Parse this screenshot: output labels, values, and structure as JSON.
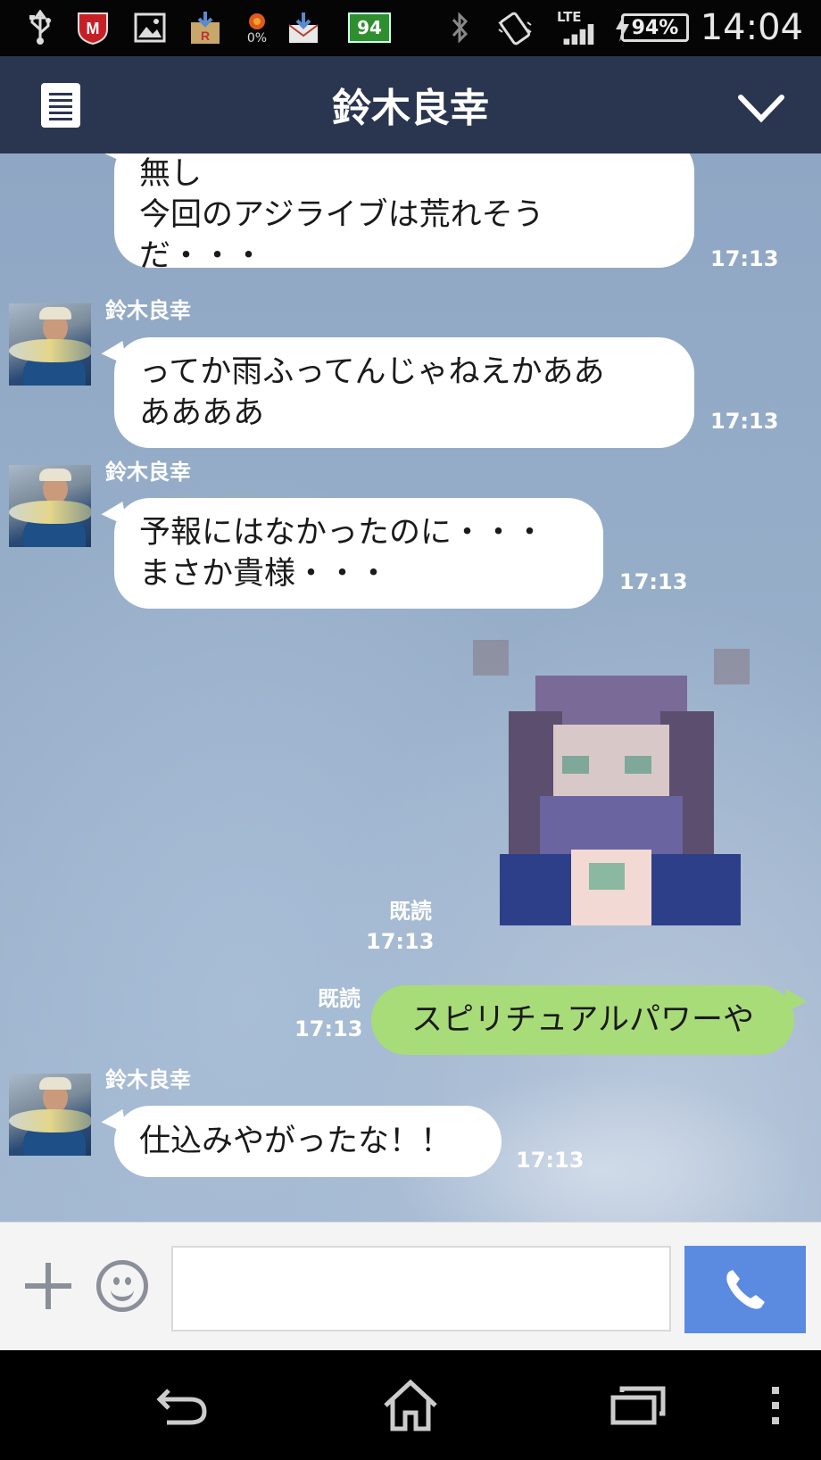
{
  "status_bar": {
    "notification_94": "94",
    "percent_badge": "0%",
    "network": "LTE",
    "battery": "94%",
    "time": "14:04"
  },
  "header": {
    "title": "鈴木良幸"
  },
  "messages": [
    {
      "side": "in",
      "lines": [
        "無し",
        "今回のアジライブは荒れそう",
        "だ・・・"
      ],
      "time": "17:13"
    },
    {
      "side": "in",
      "sender": "鈴木良幸",
      "lines": [
        "ってか雨ふってんじゃねえかああ",
        "ああああ"
      ],
      "time": "17:13"
    },
    {
      "side": "in",
      "sender": "鈴木良幸",
      "lines": [
        "予報にはなかったのに・・・",
        "まさか貴様・・・"
      ],
      "time": "17:13"
    },
    {
      "side": "out",
      "type": "sticker",
      "read": "既読",
      "time": "17:13"
    },
    {
      "side": "out",
      "lines": [
        "スピリチュアルパワーや"
      ],
      "read": "既読",
      "time": "17:13"
    },
    {
      "side": "in",
      "sender": "鈴木良幸",
      "lines": [
        "仕込みやがったな！！"
      ],
      "time": "17:13"
    }
  ],
  "input": {
    "placeholder": ""
  },
  "colors": {
    "header_bg": "#2a3550",
    "outgoing_bubble": "#a8dc78",
    "call_button": "#5b8be0"
  },
  "icons": [
    "usb-icon",
    "mcafee-icon",
    "gallery-icon",
    "download-icon",
    "cpu-icon",
    "mail-icon",
    "bluetooth-icon",
    "vibrate-icon",
    "signal-icon",
    "charging-icon",
    "menu-icon",
    "chevron-down-icon",
    "plus-icon",
    "emoji-icon",
    "phone-icon",
    "back-icon",
    "home-icon",
    "recent-apps-icon",
    "overflow-icon"
  ]
}
